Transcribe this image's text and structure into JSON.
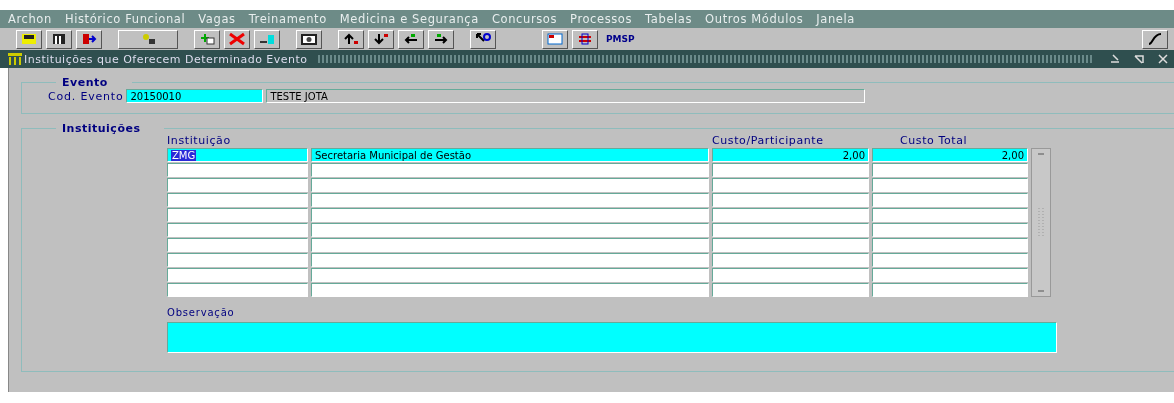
{
  "menu": [
    "Archon",
    "Histórico Funcional",
    "Vagas",
    "Treinamento",
    "Medicina e Segurança",
    "Concursos",
    "Processos",
    "Tabelas",
    "Outros Módulos",
    "Janela"
  ],
  "toolbar": {
    "brand": "PMSP"
  },
  "window": {
    "title": "Instituições que Oferecem Determinado Evento"
  },
  "evento": {
    "title": "Evento",
    "label": "Cod. Evento",
    "code": "20150010",
    "description": "TESTE JOTA"
  },
  "instituicoes": {
    "title": "Instituições",
    "columns": [
      "Instituição",
      "",
      "Custo/Participante",
      "Custo Total"
    ],
    "rows": [
      {
        "cells": [
          "ZMG",
          "Secretaria Municipal de Gestão",
          "2,00",
          "2,00"
        ],
        "current": true
      }
    ],
    "observacao_label": "Observação"
  }
}
